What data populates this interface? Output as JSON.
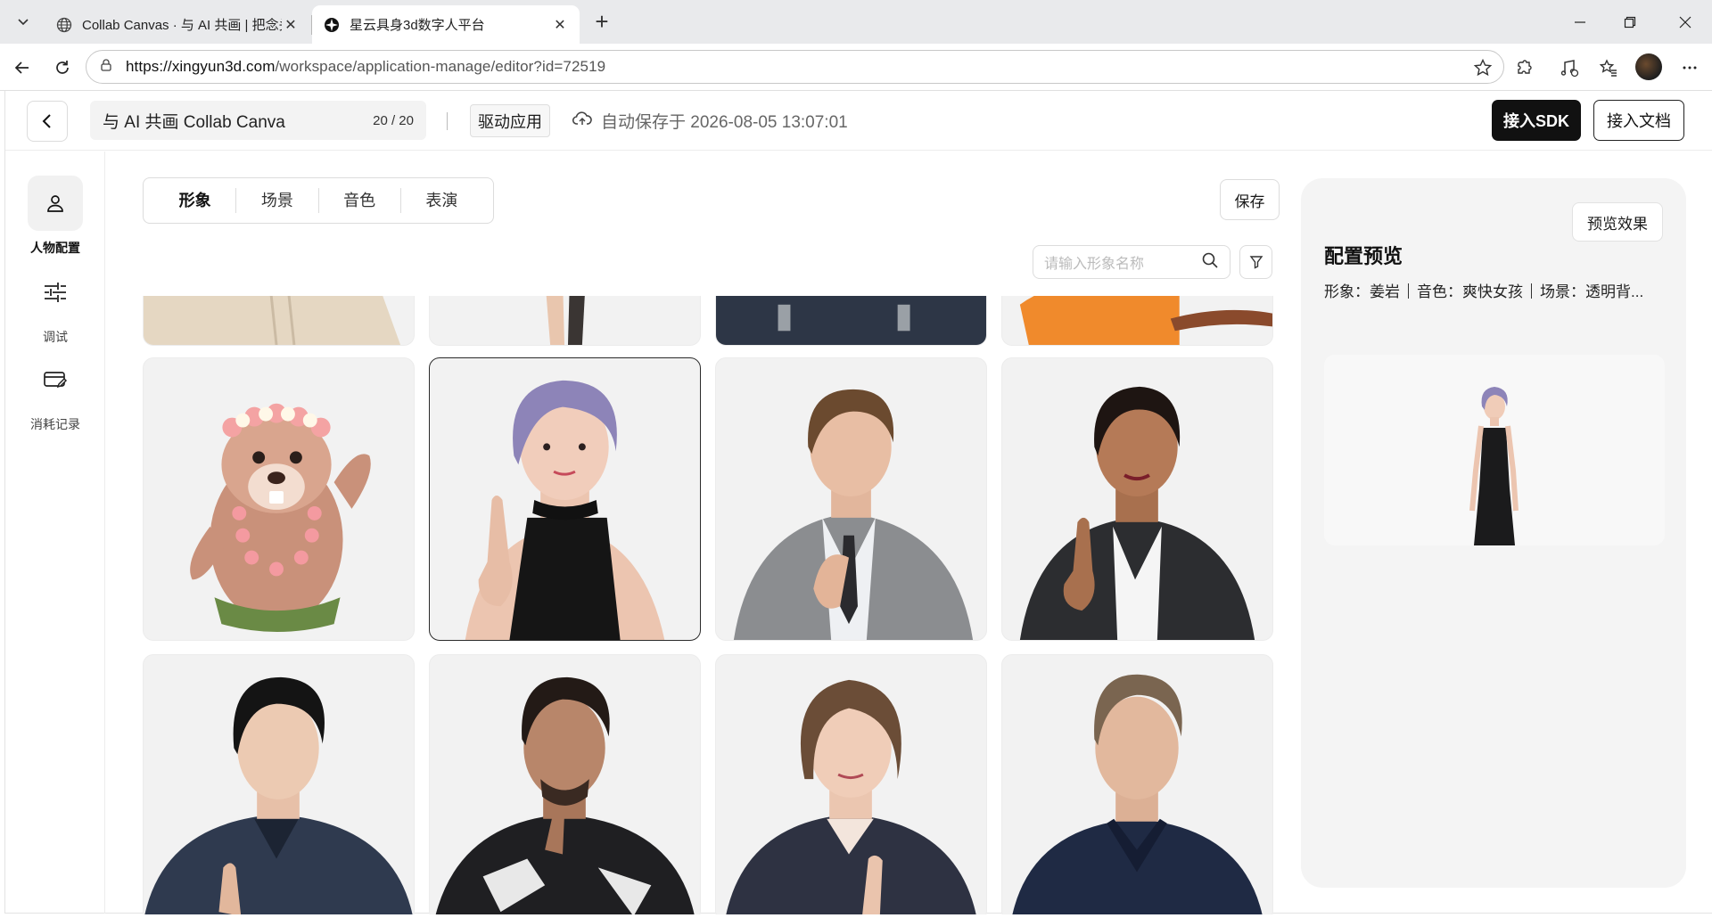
{
  "browser": {
    "tabs": [
      {
        "title": "Collab Canvas · 与 AI 共画 | 把念头",
        "active": false
      },
      {
        "title": "星云具身3d数字人平台",
        "active": true
      }
    ],
    "url_host": "https://xingyun3d.com",
    "url_path": "/workspace/application-manage/editor?id=72519"
  },
  "header": {
    "app_name": "与 AI 共画 Collab Canva",
    "name_count": "20 / 20",
    "drive_app_label": "驱动应用",
    "autosave_text": "自动保存于 2026-08-05 13:07:01",
    "sdk_button": "接入SDK",
    "doc_button": "接入文档"
  },
  "rail": {
    "items": [
      {
        "label": "人物配置",
        "icon": "person-icon",
        "active": true
      },
      {
        "label": "调试",
        "icon": "sliders-icon",
        "active": false
      },
      {
        "label": "消耗记录",
        "icon": "card-edit-icon",
        "active": false
      }
    ]
  },
  "main": {
    "tabs": [
      {
        "label": "形象",
        "active": true
      },
      {
        "label": "场景",
        "active": false
      },
      {
        "label": "音色",
        "active": false
      },
      {
        "label": "表演",
        "active": false
      }
    ],
    "save_button": "保存",
    "search_placeholder": "请输入形象名称",
    "avatars": [
      {
        "desc": "female-beige-cardigan",
        "selected": false
      },
      {
        "desc": "legs-dark-pants",
        "selected": false
      },
      {
        "desc": "male-navy-overalls",
        "selected": false
      },
      {
        "desc": "orange-jacket-tail",
        "selected": false
      },
      {
        "desc": "beaver-flower-crown",
        "selected": false
      },
      {
        "desc": "purple-hair-black-halter",
        "selected": true
      },
      {
        "desc": "male-grey-suit",
        "selected": false
      },
      {
        "desc": "female-black-leather-blazer",
        "selected": false
      },
      {
        "desc": "male-navy-shirt",
        "selected": false
      },
      {
        "desc": "male-black-jacket",
        "selected": false
      },
      {
        "desc": "female-navy-blazer",
        "selected": false
      },
      {
        "desc": "male-navy-polo",
        "selected": false
      }
    ]
  },
  "preview": {
    "button": "预览效果",
    "title": "配置预览",
    "avatar_label": "形象：姜岩",
    "voice_label": "音色：爽快女孩",
    "scene_label": "场景：透明背..."
  },
  "colors": {
    "primary_button": "#111111",
    "panel_bg": "#f4f4f4",
    "card_bg": "#f2f2f2"
  }
}
